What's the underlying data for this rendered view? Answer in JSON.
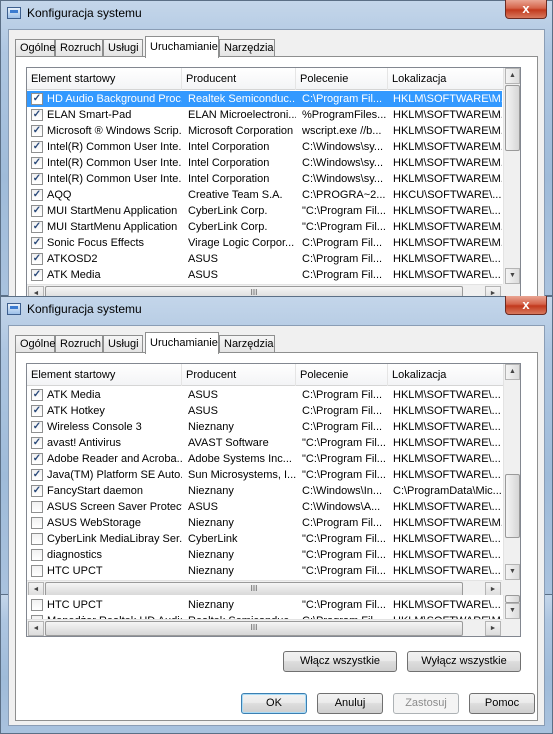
{
  "window": {
    "title": "Konfiguracja systemu",
    "close_glyph": "x",
    "tabs": [
      "Ogólne",
      "Rozruch",
      "Usługi",
      "Uruchamianie",
      "Narzędzia"
    ]
  },
  "columns": [
    "Element startowy",
    "Producent",
    "Polecenie",
    "Lokalizacja"
  ],
  "panel1_rows": [
    {
      "name": "HD Audio Background Proc...",
      "vendor": "Realtek Semiconduc...",
      "command": "C:\\Program Fil...",
      "location": "HKLM\\SOFTWARE\\M...",
      "checked": true,
      "selected": true
    },
    {
      "name": "ELAN Smart-Pad",
      "vendor": "ELAN Microelectroni...",
      "command": "%ProgramFiles...",
      "location": "HKLM\\SOFTWARE\\M...",
      "checked": true
    },
    {
      "name": "Microsoft ® Windows Scrip...",
      "vendor": "Microsoft Corporation",
      "command": "wscript.exe //b...",
      "location": "HKLM\\SOFTWARE\\M...",
      "checked": true
    },
    {
      "name": "Intel(R) Common User Inte...",
      "vendor": "Intel Corporation",
      "command": "C:\\Windows\\sy...",
      "location": "HKLM\\SOFTWARE\\M...",
      "checked": true
    },
    {
      "name": "Intel(R) Common User Inte...",
      "vendor": "Intel Corporation",
      "command": "C:\\Windows\\sy...",
      "location": "HKLM\\SOFTWARE\\M...",
      "checked": true
    },
    {
      "name": "Intel(R) Common User Inte...",
      "vendor": "Intel Corporation",
      "command": "C:\\Windows\\sy...",
      "location": "HKLM\\SOFTWARE\\M...",
      "checked": true
    },
    {
      "name": "AQQ",
      "vendor": "Creative Team S.A.",
      "command": "C:\\PROGRA~2...",
      "location": "HKCU\\SOFTWARE\\...",
      "checked": true
    },
    {
      "name": "MUI StartMenu Application",
      "vendor": "CyberLink Corp.",
      "command": "\"C:\\Program Fil...",
      "location": "HKLM\\SOFTWARE\\...",
      "checked": true
    },
    {
      "name": "MUI StartMenu Application",
      "vendor": "CyberLink Corp.",
      "command": "\"C:\\Program Fil...",
      "location": "HKLM\\SOFTWARE\\M...",
      "checked": true
    },
    {
      "name": "Sonic Focus Effects",
      "vendor": "Virage Logic Corpor...",
      "command": "C:\\Program Fil...",
      "location": "HKLM\\SOFTWARE\\M...",
      "checked": true
    },
    {
      "name": "ATKOSD2",
      "vendor": "ASUS",
      "command": "C:\\Program Fil...",
      "location": "HKLM\\SOFTWARE\\...",
      "checked": true
    },
    {
      "name": "ATK Media",
      "vendor": "ASUS",
      "command": "C:\\Program Fil...",
      "location": "HKLM\\SOFTWARE\\...",
      "checked": true
    }
  ],
  "panel2_rows": [
    {
      "name": "ATK Media",
      "vendor": "ASUS",
      "command": "C:\\Program Fil...",
      "location": "HKLM\\SOFTWARE\\...",
      "checked": true
    },
    {
      "name": "ATK Hotkey",
      "vendor": "ASUS",
      "command": "C:\\Program Fil...",
      "location": "HKLM\\SOFTWARE\\...",
      "checked": true
    },
    {
      "name": "Wireless Console 3",
      "vendor": "Nieznany",
      "command": "C:\\Program Fil...",
      "location": "HKLM\\SOFTWARE\\...",
      "checked": true
    },
    {
      "name": "avast! Antivirus",
      "vendor": "AVAST Software",
      "command": "\"C:\\Program Fil...",
      "location": "HKLM\\SOFTWARE\\...",
      "checked": true
    },
    {
      "name": "Adobe Reader and Acroba...",
      "vendor": "Adobe Systems Inc...",
      "command": "\"C:\\Program Fil...",
      "location": "HKLM\\SOFTWARE\\...",
      "checked": true
    },
    {
      "name": "Java(TM) Platform SE Auto...",
      "vendor": "Sun Microsystems, I...",
      "command": "\"C:\\Program Fil...",
      "location": "HKLM\\SOFTWARE\\...",
      "checked": true
    },
    {
      "name": "FancyStart daemon",
      "vendor": "Nieznany",
      "command": "C:\\Windows\\In...",
      "location": "C:\\ProgramData\\Mic...",
      "checked": true
    },
    {
      "name": "ASUS Screen Saver Protector",
      "vendor": "ASUS",
      "command": "C:\\Windows\\A...",
      "location": "HKLM\\SOFTWARE\\...",
      "checked": false
    },
    {
      "name": "ASUS WebStorage",
      "vendor": "Nieznany",
      "command": "C:\\Program Fil...",
      "location": "HKLM\\SOFTWARE\\M...",
      "checked": false
    },
    {
      "name": "CyberLink MediaLibray Ser...",
      "vendor": "CyberLink",
      "command": "\"C:\\Program Fil...",
      "location": "HKLM\\SOFTWARE\\...",
      "checked": false
    },
    {
      "name": "diagnostics",
      "vendor": "Nieznany",
      "command": "\"C:\\Program Fil...",
      "location": "HKLM\\SOFTWARE\\...",
      "checked": false
    },
    {
      "name": "HTC UPCT",
      "vendor": "Nieznany",
      "command": "\"C:\\Program Fil...",
      "location": "HKLM\\SOFTWARE\\...",
      "checked": false
    }
  ],
  "panel3_rows": [
    {
      "name": "HTC UPCT",
      "vendor": "Nieznany",
      "command": "\"C:\\Program Fil...",
      "location": "HKLM\\SOFTWARE\\...",
      "checked": false
    },
    {
      "name": "Menedżer Realtek HD Audio",
      "vendor": "Realtek Semiconduc...",
      "command": "C:\\Program Fil...",
      "location": "HKLM\\SOFTWARE\\M...",
      "checked": false
    }
  ],
  "scrollbar": {
    "thumb_grip": "III",
    "arrow_up": "▲",
    "arrow_down": "▼",
    "arrow_left": "◄",
    "arrow_right": "►"
  },
  "actions": {
    "enable_all": "Włącz wszystkie",
    "disable_all": "Wyłącz wszystkie"
  },
  "dialog_buttons": {
    "ok": "OK",
    "cancel": "Anuluj",
    "apply": "Zastosuj",
    "help": "Pomoc"
  },
  "colors": {
    "selection": "#3399ff",
    "glass": "#a9c2de",
    "close": "#c2391d"
  }
}
